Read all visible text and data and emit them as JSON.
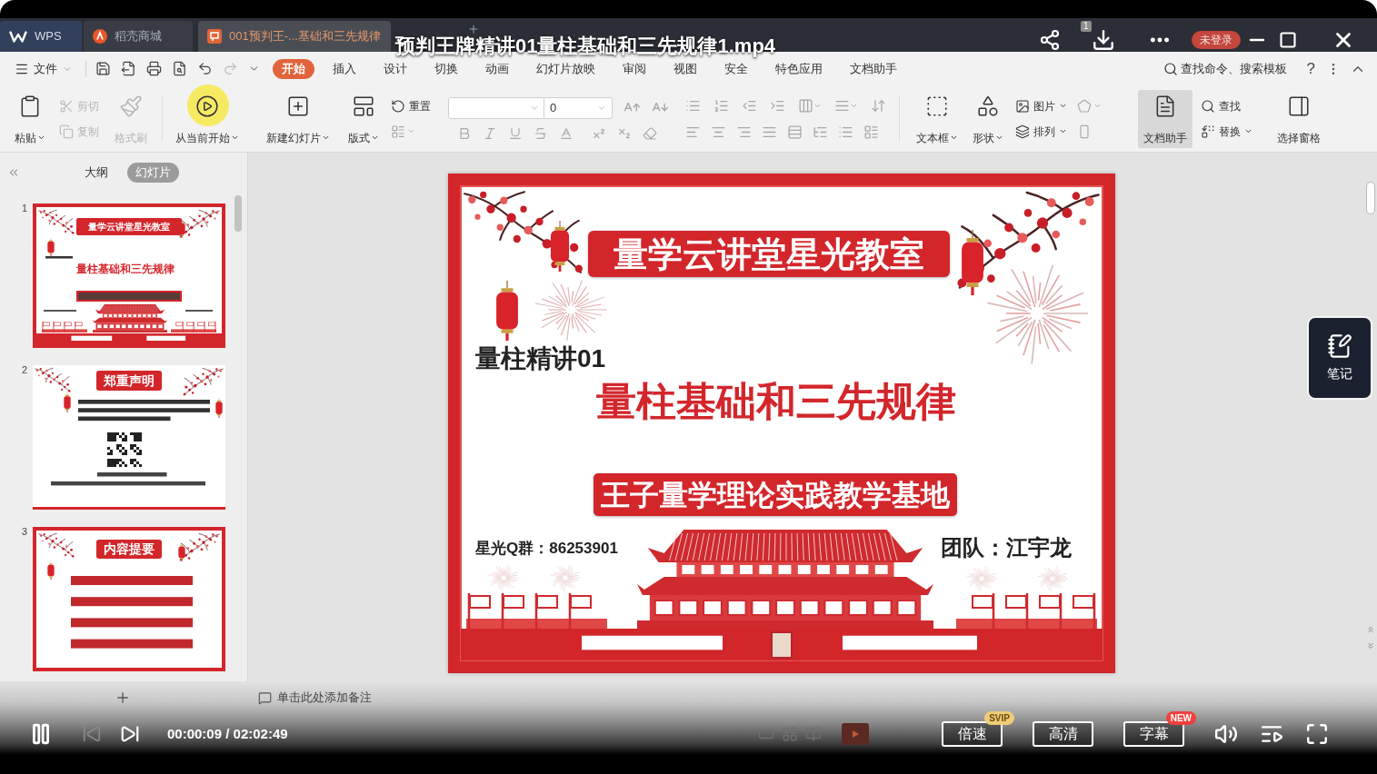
{
  "player": {
    "title": "预判王牌精讲01量柱基础和三先规律1.mp4",
    "download_count": "1",
    "playing": true,
    "time": "00:00:09 / 02:02:49",
    "buttons": [
      {
        "label": "倍速",
        "badge": {
          "label": "SVIP",
          "color": "#efcd78"
        }
      },
      {
        "label": "高清"
      },
      {
        "label": "字幕",
        "badge": {
          "label": "NEW",
          "color": "#f0413c"
        }
      }
    ],
    "notes_button": "笔记"
  },
  "app_tabs": [
    {
      "kind": "home",
      "label": "WPS",
      "selected": false
    },
    {
      "kind": "store",
      "label": "稻壳商城",
      "selected": false
    },
    {
      "kind": "document",
      "label": "001预判王-...基础和三先规律",
      "selected": true
    }
  ],
  "login_badge": "未登录",
  "menu": {
    "file": "文件",
    "items": [
      {
        "label": "开始",
        "selected": true
      },
      {
        "label": "插入",
        "selected": false
      },
      {
        "label": "设计",
        "selected": false
      },
      {
        "label": "切换",
        "selected": false
      },
      {
        "label": "动画",
        "selected": false
      },
      {
        "label": "幻灯片放映",
        "selected": false
      },
      {
        "label": "审阅",
        "selected": false
      },
      {
        "label": "视图",
        "selected": false
      },
      {
        "label": "安全",
        "selected": false
      },
      {
        "label": "特色应用",
        "selected": false
      },
      {
        "label": "文档助手",
        "selected": false
      }
    ],
    "search_label": "查找命令、搜索模板",
    "help": "?"
  },
  "ribbon": {
    "paste": {
      "label": "粘贴",
      "dropdown": true
    },
    "cut": {
      "label": "剪切",
      "disabled": true
    },
    "copy": {
      "label": "复制",
      "disabled": true
    },
    "format_painter": {
      "label": "格式刷",
      "disabled": true
    },
    "play_from_current": {
      "label": "从当前开始",
      "dropdown": true
    },
    "new_slide": {
      "label": "新建幻灯片",
      "dropdown": true
    },
    "layout": {
      "label": "版式",
      "dropdown": true
    },
    "reset": {
      "label": "重置"
    },
    "font_size": "0",
    "text_box": {
      "label": "文本框",
      "dropdown": true
    },
    "shape": {
      "label": "形状",
      "dropdown": true
    },
    "picture": {
      "label": "图片",
      "dropdown": true
    },
    "arrange": {
      "label": "排列",
      "dropdown": true
    },
    "document_assistant": {
      "label": "文档助手",
      "selected": true
    },
    "find": {
      "label": "查找"
    },
    "replace": {
      "label": "替换",
      "dropdown": true
    },
    "selection_pane": {
      "label": "选择窗格"
    }
  },
  "side_panel": {
    "tabs": [
      {
        "label": "大纲",
        "selected": false
      },
      {
        "label": "幻灯片",
        "selected": true
      }
    ],
    "thumbnails": [
      {
        "number": "1",
        "kind": "title",
        "heading": "量学云讲堂星光教室",
        "subtitle": "量柱基础和三先规律"
      },
      {
        "number": "2",
        "kind": "notice",
        "heading": "郑重声明"
      },
      {
        "number": "3",
        "kind": "contents",
        "heading": "内容提要"
      }
    ]
  },
  "slide": {
    "banner_title": "量学云讲堂星光教室",
    "series": "量柱精讲01",
    "title": "量柱基础和三先规律",
    "banner_subtitle": "王子量学理论实践教学基地",
    "group": "星光Q群：86253901",
    "team": "团队：江宇龙"
  },
  "notes": {
    "placeholder": "单击此处添加备注"
  }
}
